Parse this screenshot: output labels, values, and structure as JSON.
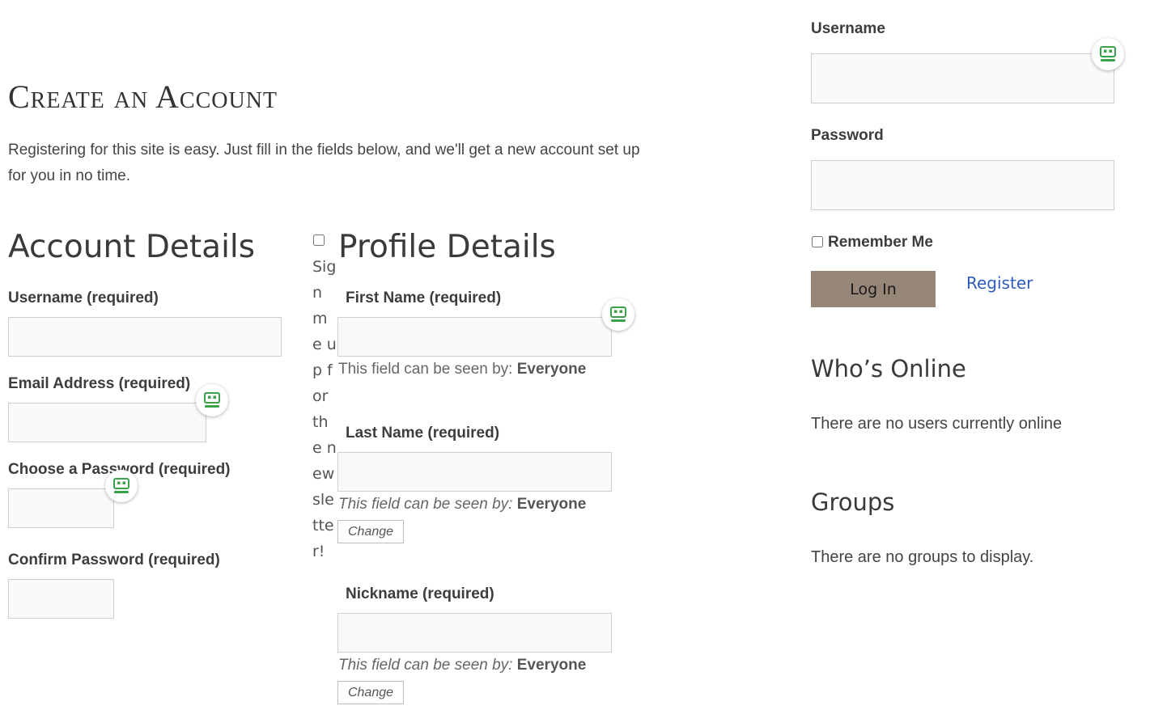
{
  "register": {
    "title": "Create an Account",
    "intro": "Registering for this site is easy. Just fill in the fields below, and we'll get a new account set up for you in no time.",
    "account": {
      "heading": "Account Details",
      "username_label": "Username (required)",
      "email_label": "Email Address (required)",
      "password_label": "Choose a Password (required)",
      "confirm_label": "Confirm Password (required)"
    },
    "newsletter_label": "Sign me up for the newsletter!",
    "profile": {
      "heading": "Profile Details",
      "first_name_label": "First Name (required)",
      "last_name_label": "Last Name (required)",
      "nickname_label": "Nickname (required)",
      "visibility_prefix": "This field can be seen by:",
      "visibility_value": "Everyone",
      "change_label": "Change"
    }
  },
  "sidebar": {
    "username_label": "Username",
    "password_label": "Password",
    "remember_label": "Remember Me",
    "login_label": "Log In",
    "register_label": "Register",
    "whos_online": {
      "heading": "Who’s Online",
      "text": "There are no users currently online"
    },
    "groups": {
      "heading": "Groups",
      "text": "There are no groups to display."
    }
  },
  "colors": {
    "login_button": "#968677",
    "link": "#2e5bbf",
    "password_manager": "#3aa24a"
  },
  "icons": {
    "password_manager": "password-manager-icon"
  }
}
